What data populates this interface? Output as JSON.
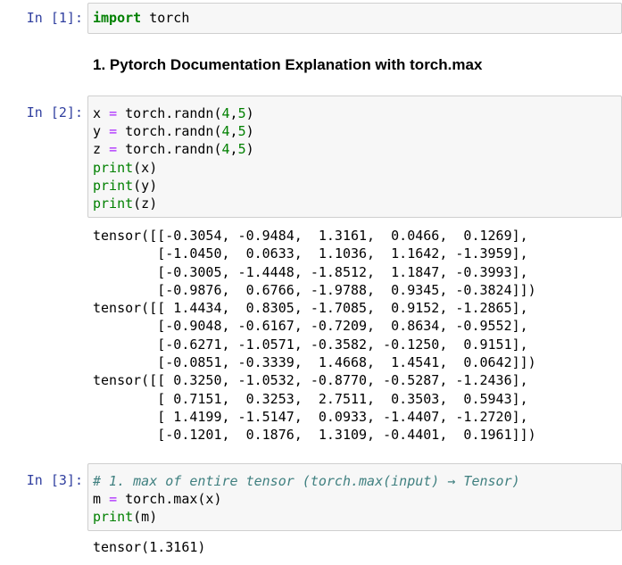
{
  "cells": [
    {
      "prompt": "In  [1]:",
      "code": [
        [
          {
            "t": "import",
            "c": "kw"
          },
          {
            "t": " torch",
            "c": ""
          }
        ]
      ]
    },
    {
      "markdown": "1. Pytorch Documentation Explanation with torch.max"
    },
    {
      "prompt": "In  [2]:",
      "code": [
        [
          {
            "t": "x ",
            "c": ""
          },
          {
            "t": "=",
            "c": "op"
          },
          {
            "t": " torch.randn(",
            "c": ""
          },
          {
            "t": "4",
            "c": "nm"
          },
          {
            "t": ",",
            "c": ""
          },
          {
            "t": "5",
            "c": "nm"
          },
          {
            "t": ")",
            "c": ""
          }
        ],
        [
          {
            "t": "y ",
            "c": ""
          },
          {
            "t": "=",
            "c": "op"
          },
          {
            "t": " torch.randn(",
            "c": ""
          },
          {
            "t": "4",
            "c": "nm"
          },
          {
            "t": ",",
            "c": ""
          },
          {
            "t": "5",
            "c": "nm"
          },
          {
            "t": ")",
            "c": ""
          }
        ],
        [
          {
            "t": "z ",
            "c": ""
          },
          {
            "t": "=",
            "c": "op"
          },
          {
            "t": " torch.randn(",
            "c": ""
          },
          {
            "t": "4",
            "c": "nm"
          },
          {
            "t": ",",
            "c": ""
          },
          {
            "t": "5",
            "c": "nm"
          },
          {
            "t": ")",
            "c": ""
          }
        ],
        [
          {
            "t": "print",
            "c": "bi"
          },
          {
            "t": "(x)",
            "c": ""
          }
        ],
        [
          {
            "t": "print",
            "c": "bi"
          },
          {
            "t": "(y)",
            "c": ""
          }
        ],
        [
          {
            "t": "print",
            "c": "bi"
          },
          {
            "t": "(z)",
            "c": ""
          }
        ]
      ],
      "output": [
        "tensor([[-0.3054, -0.9484,  1.3161,  0.0466,  0.1269],",
        "        [-1.0450,  0.0633,  1.1036,  1.1642, -1.3959],",
        "        [-0.3005, -1.4448, -1.8512,  1.1847, -0.3993],",
        "        [-0.9876,  0.6766, -1.9788,  0.9345, -0.3824]])",
        "tensor([[ 1.4434,  0.8305, -1.7085,  0.9152, -1.2865],",
        "        [-0.9048, -0.6167, -0.7209,  0.8634, -0.9552],",
        "        [-0.6271, -1.0571, -0.3582, -0.1250,  0.9151],",
        "        [-0.0851, -0.3339,  1.4668,  1.4541,  0.0642]])",
        "tensor([[ 0.3250, -1.0532, -0.8770, -0.5287, -1.2436],",
        "        [ 0.7151,  0.3253,  2.7511,  0.3503,  0.5943],",
        "        [ 1.4199, -1.5147,  0.0933, -1.4407, -1.2720],",
        "        [-0.1201,  0.1876,  1.3109, -0.4401,  0.1961]])"
      ]
    },
    {
      "prompt": "In  [3]:",
      "code": [
        [
          {
            "t": "# 1. max of entire tensor (torch.max(input) → Tensor)",
            "c": "cm"
          }
        ],
        [
          {
            "t": "m ",
            "c": ""
          },
          {
            "t": "=",
            "c": "op"
          },
          {
            "t": " torch.max(x)",
            "c": ""
          }
        ],
        [
          {
            "t": "print",
            "c": "bi"
          },
          {
            "t": "(m)",
            "c": ""
          }
        ]
      ],
      "output": [
        "tensor(1.3161)"
      ]
    }
  ]
}
